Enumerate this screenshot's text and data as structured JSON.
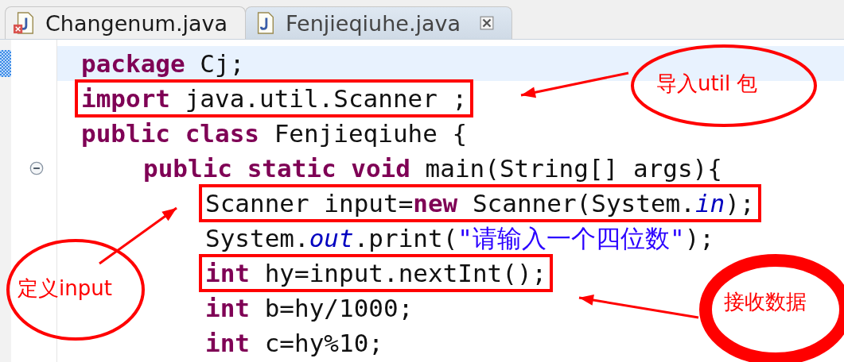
{
  "tabs": [
    {
      "label": "Changenum.java",
      "selected": false,
      "error": true
    },
    {
      "label": "Fenjieqiuhe.java",
      "selected": true,
      "error": false
    }
  ],
  "editor": {
    "lines": [
      {
        "current": true,
        "boxed": false,
        "tokens": [
          {
            "text": "package",
            "kind": "keyword"
          },
          {
            "text": " Cj;",
            "kind": "plain"
          }
        ]
      },
      {
        "current": false,
        "boxed": true,
        "tokens": [
          {
            "text": "import",
            "kind": "keyword"
          },
          {
            "text": " java.util.Scanner ;",
            "kind": "plain"
          }
        ]
      },
      {
        "current": false,
        "boxed": false,
        "tokens": [
          {
            "text": "public class",
            "kind": "keyword"
          },
          {
            "text": " Fenjieqiuhe {",
            "kind": "plain"
          }
        ],
        "children": [
          {
            "current": false,
            "boxed": false,
            "expanded": true,
            "tokens": [
              {
                "text": "public static void",
                "kind": "keyword"
              },
              {
                "text": " main(String[] args){",
                "kind": "plain"
              }
            ],
            "children": [
              {
                "current": false,
                "boxed": true,
                "tokens": [
                  {
                    "text": "Scanner input=",
                    "kind": "plain"
                  },
                  {
                    "text": "new",
                    "kind": "keyword"
                  },
                  {
                    "text": " Scanner(System.",
                    "kind": "plain"
                  },
                  {
                    "text": "in",
                    "kind": "field"
                  },
                  {
                    "text": ");",
                    "kind": "plain"
                  }
                ]
              },
              {
                "current": false,
                "boxed": false,
                "tokens": [
                  {
                    "text": "System.",
                    "kind": "plain"
                  },
                  {
                    "text": "out",
                    "kind": "field"
                  },
                  {
                    "text": ".print(",
                    "kind": "plain"
                  },
                  {
                    "text": "\"请输入一个四位数\"",
                    "kind": "string"
                  },
                  {
                    "text": ");",
                    "kind": "plain"
                  }
                ]
              },
              {
                "current": false,
                "boxed": true,
                "tokens": [
                  {
                    "text": "int",
                    "kind": "keyword"
                  },
                  {
                    "text": " hy=input.nextInt();",
                    "kind": "plain"
                  }
                ]
              },
              {
                "current": false,
                "boxed": false,
                "tokens": [
                  {
                    "text": "int",
                    "kind": "keyword"
                  },
                  {
                    "text": " b=hy/1000;",
                    "kind": "plain"
                  }
                ]
              },
              {
                "current": false,
                "boxed": false,
                "tokens": [
                  {
                    "text": "int",
                    "kind": "keyword"
                  },
                  {
                    "text": " c=hy%10;",
                    "kind": "plain"
                  }
                ]
              }
            ]
          }
        ]
      }
    ]
  },
  "annotations": [
    {
      "text": "导入util 包",
      "kind": "circled"
    },
    {
      "text": "定义input",
      "kind": "circled"
    },
    {
      "text": "接收数据",
      "kind": "scribbled"
    }
  ]
}
